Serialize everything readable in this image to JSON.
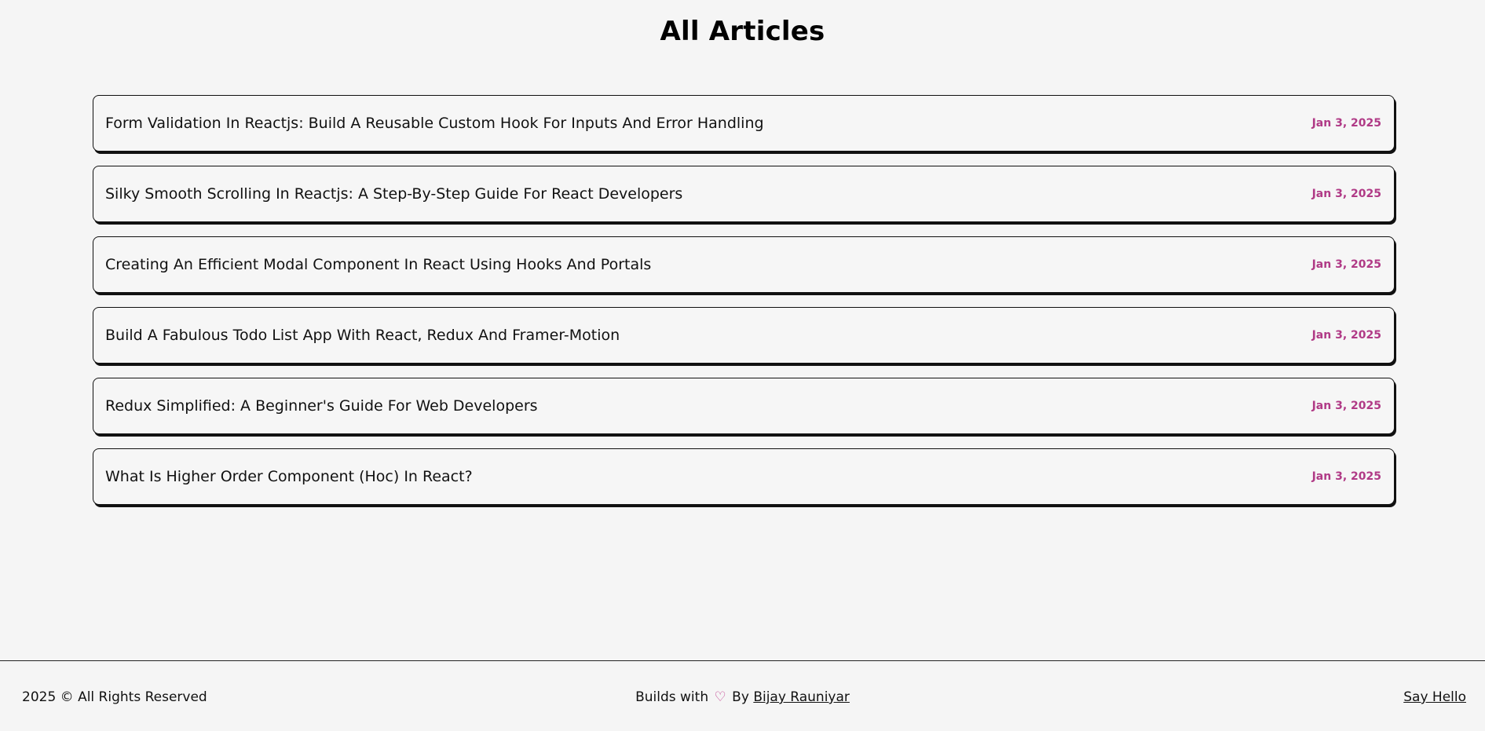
{
  "page": {
    "title": "All Articles"
  },
  "articles": [
    {
      "title": "Form Validation In Reactjs: Build A Reusable Custom Hook For Inputs And Error Handling",
      "date": "Jan 3, 2025"
    },
    {
      "title": "Silky Smooth Scrolling In Reactjs: A Step-By-Step Guide For React Developers",
      "date": "Jan 3, 2025"
    },
    {
      "title": "Creating An Efficient Modal Component In React Using Hooks And Portals",
      "date": "Jan 3, 2025"
    },
    {
      "title": "Build A Fabulous Todo List App With React, Redux And Framer-Motion",
      "date": "Jan 3, 2025"
    },
    {
      "title": "Redux Simplified: A Beginner's Guide For Web Developers",
      "date": "Jan 3, 2025"
    },
    {
      "title": "What Is Higher Order Component (Hoc) In React?",
      "date": "Jan 3, 2025"
    }
  ],
  "footer": {
    "copyright": "2025 © All Rights Reserved",
    "builds_with": "Builds with",
    "heart_icon": "♡",
    "by": "By",
    "author": "Bijay Rauniyar",
    "say_hello": "Say Hello"
  },
  "colors": {
    "background": "#f5f5f5",
    "accent_date": "#b03a86",
    "heart": "#c2408f",
    "border": "#111111"
  }
}
